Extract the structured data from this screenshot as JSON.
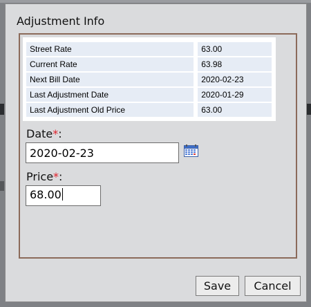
{
  "dialog": {
    "title": "Adjustment Info"
  },
  "info_table": {
    "rows": [
      {
        "label": "Street Rate",
        "value": "63.00"
      },
      {
        "label": "Current Rate",
        "value": "63.98"
      },
      {
        "label": "Next Bill Date",
        "value": "2020-02-23"
      },
      {
        "label": "Last Adjustment Date",
        "value": "2020-01-29"
      },
      {
        "label": "Last Adjustment Old Price",
        "value": "63.00"
      }
    ]
  },
  "form": {
    "date_label": "Date",
    "date_value": "2020-02-23",
    "price_label": "Price",
    "price_value": "68.00",
    "required_marker": "*",
    "label_suffix": ":"
  },
  "buttons": {
    "save_label": "Save",
    "cancel_label": "Cancel"
  },
  "icons": {
    "calendar": "calendar-icon"
  },
  "colors": {
    "required": "#e0202a",
    "fieldset_border": "#8b6a5a",
    "row_background": "#e6ecf5"
  }
}
